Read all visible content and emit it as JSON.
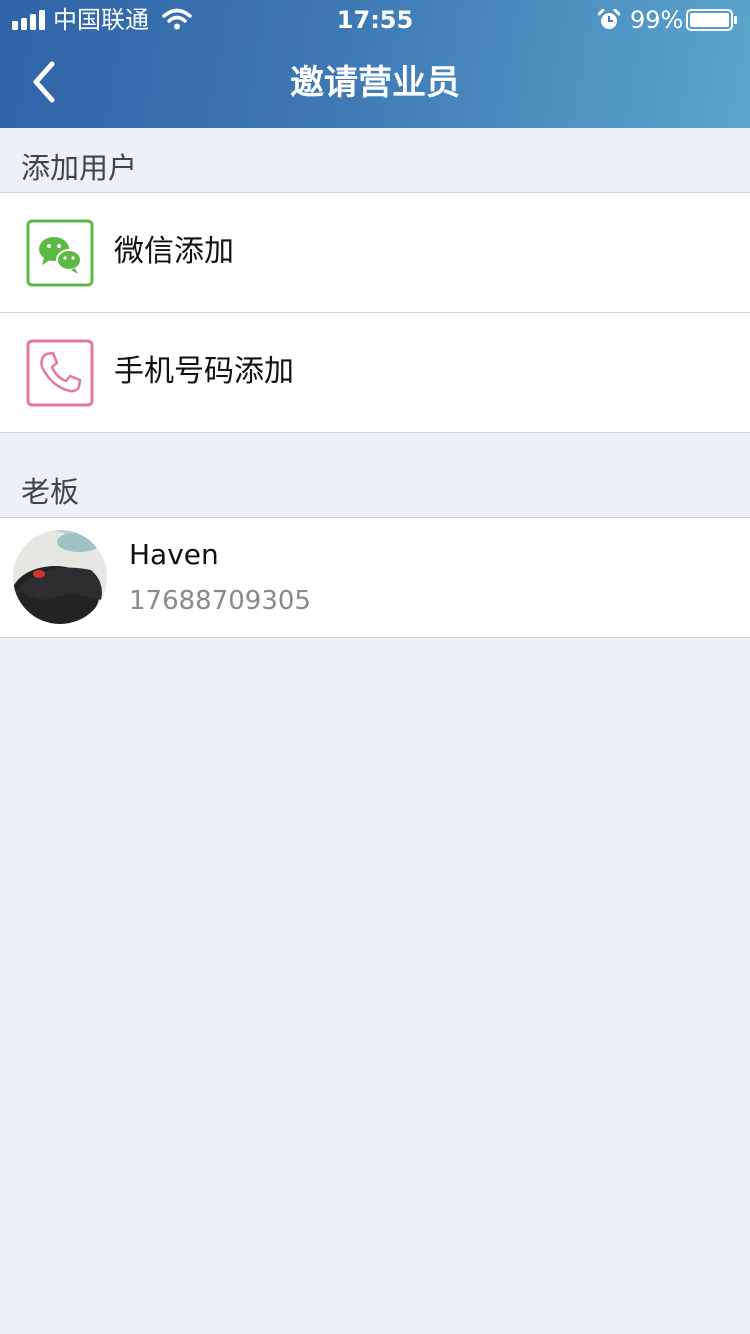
{
  "status_bar": {
    "carrier": "中国联通",
    "time": "17:55",
    "battery": "99%",
    "icons": [
      "signal-bars-icon",
      "wifi-icon",
      "alarm-clock-icon",
      "battery-icon"
    ]
  },
  "nav": {
    "title": "邀请营业员",
    "back_icon": "chevron-left-icon"
  },
  "sections": {
    "add_users": {
      "header": "添加用户",
      "items": [
        {
          "label": "微信添加",
          "icon": "wechat-icon",
          "color": "#5cb944"
        },
        {
          "label": "手机号码添加",
          "icon": "phone-icon",
          "color": "#e47a98"
        }
      ]
    },
    "boss": {
      "header": "老板",
      "member": {
        "name": "Haven",
        "phone": "17688709305",
        "avatar": "mouse-photo-avatar"
      }
    }
  },
  "colors": {
    "header_start": "#2f64a8",
    "header_end": "#5aa6cc",
    "page_background": "#ecf0f8",
    "divider": "#cfd3d9"
  }
}
